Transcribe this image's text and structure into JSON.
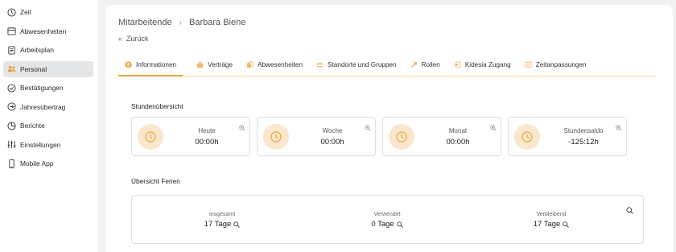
{
  "sidebar": {
    "items": [
      {
        "label": "Zeit",
        "icon": "clock-icon"
      },
      {
        "label": "Abwesenheiten",
        "icon": "calendar-icon"
      },
      {
        "label": "Arbeitsplan",
        "icon": "document-icon"
      },
      {
        "label": "Personal",
        "icon": "users-icon",
        "active": true
      },
      {
        "label": "Bestätigungen",
        "icon": "check-circle-icon"
      },
      {
        "label": "Jahresübertrag",
        "icon": "arrow-circle-icon"
      },
      {
        "label": "Berichte",
        "icon": "pie-chart-icon"
      },
      {
        "label": "Einstellungen",
        "icon": "sliders-icon"
      },
      {
        "label": "Mobile App",
        "icon": "mobile-icon"
      }
    ]
  },
  "breadcrumb": {
    "parent": "Mitarbeitende",
    "separator": "›",
    "current": "Barbara Biene"
  },
  "back": {
    "label": "Zurück"
  },
  "tabs": [
    {
      "label": "Informationen",
      "icon": "user-circle-icon",
      "active": true
    },
    {
      "label": "Verträge",
      "icon": "briefcase-icon"
    },
    {
      "label": "Abwesenheiten",
      "icon": "copy-icon"
    },
    {
      "label": "Standorte und Gruppen",
      "icon": "group-icon"
    },
    {
      "label": "Rollen",
      "icon": "key-icon"
    },
    {
      "label": "Kidesia Zugang",
      "icon": "login-icon"
    },
    {
      "label": "Zeitanpassungen",
      "icon": "adjust-icon"
    }
  ],
  "hours": {
    "title": "Stundenübersicht",
    "cards": [
      {
        "label": "Heute",
        "value": "00:00h"
      },
      {
        "label": "Woche",
        "value": "00:00h"
      },
      {
        "label": "Monat",
        "value": "00:00h"
      },
      {
        "label": "Stundensaldo",
        "value": "-125:12h"
      }
    ]
  },
  "holidays": {
    "title": "Übersicht Ferien",
    "items": [
      {
        "label": "Insgesamt",
        "value": "17 Tage"
      },
      {
        "label": "Verwendet",
        "value": "0 Tage"
      },
      {
        "label": "Verbleibend",
        "value": "17 Tage"
      }
    ]
  },
  "colors": {
    "accent": "#e8a43a",
    "accent_light": "#fbe7cc",
    "active_nav": "#e4e5e7"
  }
}
